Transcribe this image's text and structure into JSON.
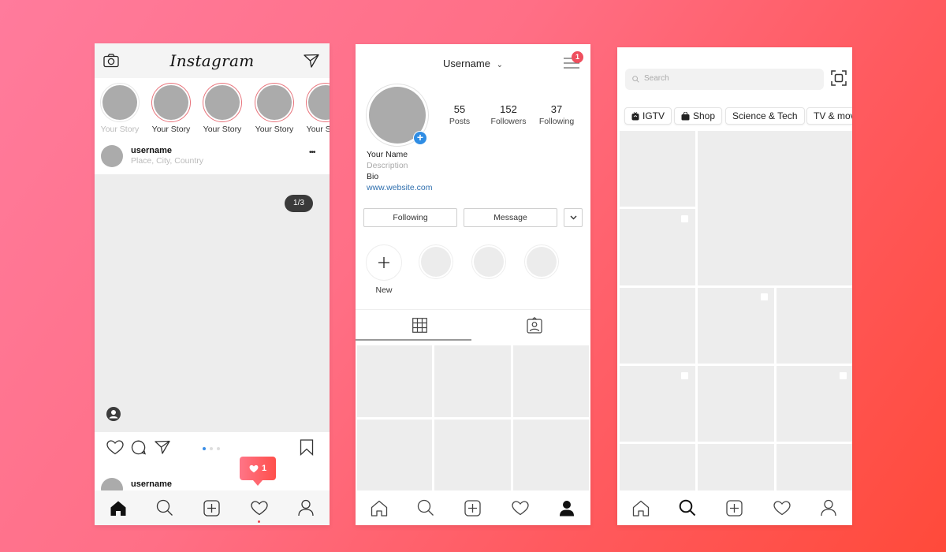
{
  "colors": {
    "background_start": "#ff7b9c",
    "background_end": "#ff4a3a",
    "story_ring": "#e8737b",
    "notification": "#ef4f5e",
    "link": "#2f6fae",
    "add_badge": "#2f8de4"
  },
  "feed": {
    "app_title": "Instagram",
    "header_icons": [
      "camera-icon",
      "direct-message-icon"
    ],
    "stories": [
      {
        "label": "Your Story",
        "own": true
      },
      {
        "label": "Your Story",
        "own": false
      },
      {
        "label": "Your Story",
        "own": false
      },
      {
        "label": "Your Story",
        "own": false
      },
      {
        "label": "Your Story",
        "own": false
      }
    ],
    "post": {
      "username": "username",
      "location": "Place, City,  Country",
      "more": "•••",
      "counter": "1/3",
      "carousel_total": 3,
      "carousel_active": 1
    },
    "actions": [
      "like-icon",
      "comment-icon",
      "share-icon",
      "bookmark-icon"
    ],
    "next_post_username": "username",
    "notification": {
      "count": "1"
    },
    "nav": [
      "home",
      "search",
      "add",
      "activity",
      "profile"
    ],
    "nav_active": "home"
  },
  "profile": {
    "title": "Username",
    "menu_badge": "1",
    "stats": [
      {
        "value": "55",
        "label": "Posts"
      },
      {
        "value": "152",
        "label": "Followers"
      },
      {
        "value": "37",
        "label": "Following"
      }
    ],
    "name": "Your Name",
    "description": "Description",
    "bio": "Bio",
    "website": "www.website.com",
    "buttons": {
      "following": "Following",
      "message": "Message"
    },
    "highlights": {
      "new_label": "New",
      "count": 3
    },
    "tabs": [
      "grid",
      "tagged"
    ],
    "active_tab": "grid",
    "nav_active": "profile"
  },
  "explore": {
    "search_placeholder": "Search",
    "chips": [
      {
        "label": "IGTV",
        "icon": "igtv-icon"
      },
      {
        "label": "Shop",
        "icon": "shop-bag-icon"
      },
      {
        "label": "Science & Tech",
        "icon": ""
      },
      {
        "label": "TV & movies",
        "icon": ""
      }
    ],
    "nav_active": "search"
  }
}
